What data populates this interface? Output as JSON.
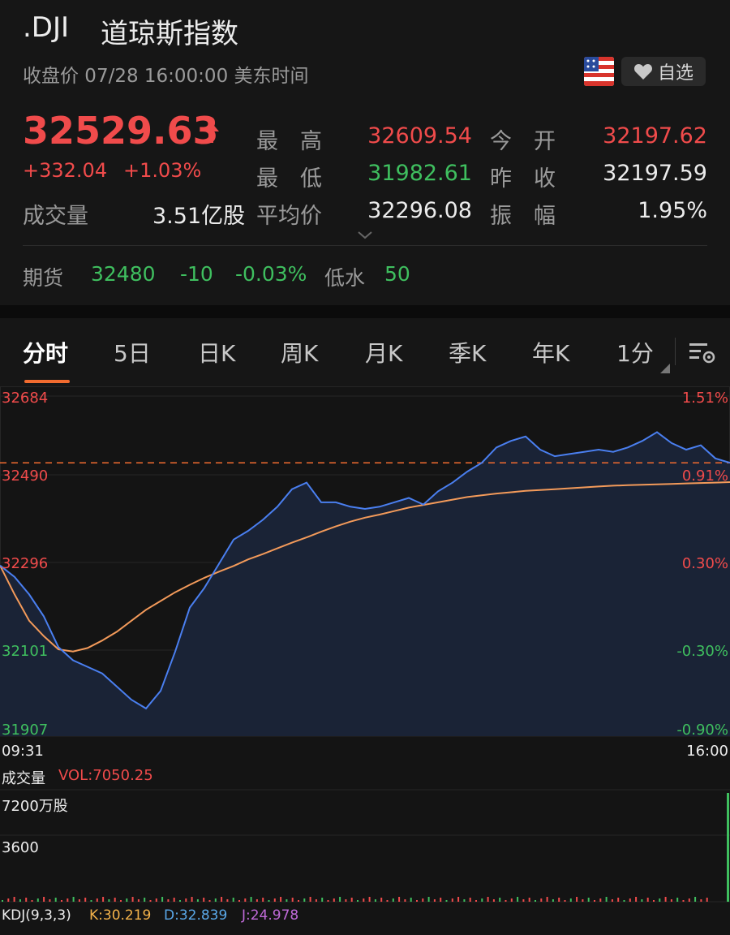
{
  "header": {
    "symbol": ".DJI",
    "name": "道琼斯指数",
    "status": "收盘价 07/28 16:00:00 美东时间",
    "favorite_label": "自选",
    "flag_icon": "us-flag-icon",
    "price": "32529.63",
    "price_arrow": "up-arrow-icon",
    "change": "+332.04",
    "change_pct": "+1.03%",
    "volume_label": "成交量",
    "volume_value": "3.51亿股",
    "stats": {
      "high_label": "最　高",
      "high_value": "32609.54",
      "low_label": "最　低",
      "low_value": "31982.61",
      "avg_label": "平均价",
      "avg_value": "32296.08",
      "open_label": "今　开",
      "open_value": "32197.62",
      "prev_label": "昨　收",
      "prev_value": "32197.59",
      "amp_label": "振　幅",
      "amp_value": "1.95%"
    },
    "futures": {
      "label": "期货",
      "price": "32480",
      "change": "-10",
      "change_pct": "-0.03%",
      "basis_label": "低水",
      "basis_value": "50"
    }
  },
  "tabs": [
    "分时",
    "5日",
    "日K",
    "周K",
    "月K",
    "季K",
    "年K",
    "1分"
  ],
  "active_tab": "分时",
  "colors": {
    "up": "#f04b4b",
    "down": "#3fbf5f",
    "price_line": "#4a7ff0",
    "avg_line": "#f39a5a",
    "accent": "#f26b2f"
  },
  "chart_data": {
    "type": "line",
    "y_left_ticks": [
      "32684",
      "32490",
      "32296",
      "32101",
      "31907"
    ],
    "y_right_ticks": [
      "1.51%",
      "0.91%",
      "0.30%",
      "-0.30%",
      "-0.90%"
    ],
    "ylim": [
      31907,
      32684
    ],
    "prev_close": 32197.59,
    "x_start": "09:31",
    "x_end": "16:00",
    "series": [
      {
        "values": [
          32296,
          32270,
          32230,
          32180,
          32110,
          32080,
          32065,
          32050,
          32020,
          31990,
          31970,
          32010,
          32100,
          32200,
          32245,
          32300,
          32355,
          32375,
          32400,
          32430,
          32470,
          32485,
          32440,
          32440,
          32430,
          32425,
          32430,
          32440,
          32450,
          32435,
          32465,
          32485,
          32510,
          32530,
          32565,
          32580,
          32590,
          32560,
          32545,
          32550,
          32555,
          32560,
          32555,
          32565,
          32580,
          32600,
          32575,
          32560,
          32570,
          32540,
          32530
        ]
      },
      {
        "values": [
          32296,
          32230,
          32170,
          32135,
          32105,
          32100,
          32108,
          32125,
          32145,
          32170,
          32195,
          32215,
          32235,
          32252,
          32268,
          32282,
          32295,
          32310,
          32322,
          32335,
          32348,
          32360,
          32373,
          32385,
          32396,
          32405,
          32412,
          32420,
          32428,
          32434,
          32440,
          32446,
          32452,
          32456,
          32460,
          32463,
          32466,
          32468,
          32470,
          32472,
          32474,
          32476,
          32478,
          32479,
          32480,
          32481,
          32482,
          32483,
          32484,
          32485,
          32486
        ]
      }
    ],
    "volume": {
      "label": "成交量",
      "vol_text": "VOL:7050.25",
      "top_tick": "7200万股",
      "mid_tick": "3600"
    },
    "kdj": {
      "label": "KDJ(9,3,3)",
      "k": "K:30.219",
      "d": "D:32.839",
      "j": "J:24.978"
    }
  }
}
